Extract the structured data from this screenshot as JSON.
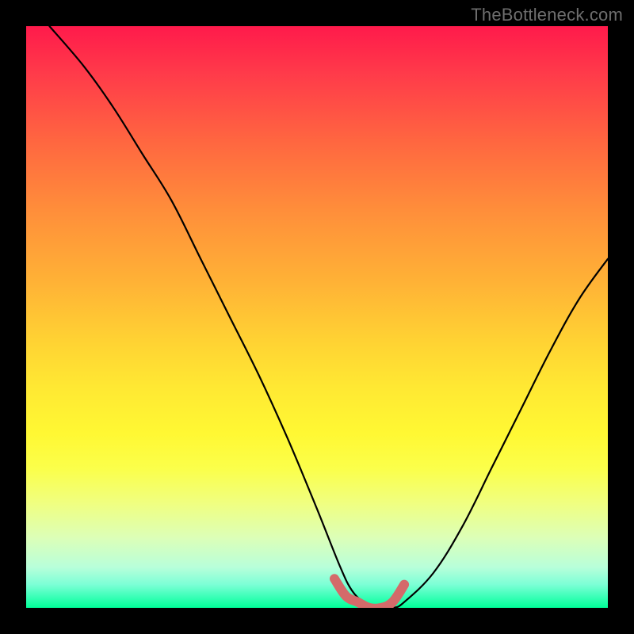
{
  "watermark": "TheBottleneck.com",
  "chart_data": {
    "type": "line",
    "title": "",
    "xlabel": "",
    "ylabel": "",
    "xlim": [
      0,
      100
    ],
    "ylim": [
      0,
      100
    ],
    "grid": false,
    "legend": false,
    "background": {
      "gradient": "vertical",
      "stops": [
        {
          "pos": 0,
          "color": "#ff1a4b"
        },
        {
          "pos": 20,
          "color": "#ff6740"
        },
        {
          "pos": 50,
          "color": "#ffd233"
        },
        {
          "pos": 80,
          "color": "#f0ff80"
        },
        {
          "pos": 100,
          "color": "#00ff99"
        }
      ]
    },
    "series": [
      {
        "name": "bottleneck-curve",
        "stroke": "#000000",
        "x": [
          4,
          10,
          15,
          20,
          25,
          30,
          35,
          40,
          45,
          50,
          54,
          56,
          58,
          60,
          63,
          65,
          70,
          75,
          80,
          85,
          90,
          95,
          100
        ],
        "y": [
          100,
          93,
          86,
          78,
          70,
          60,
          50,
          40,
          29,
          17,
          7,
          3,
          1,
          0,
          0,
          1,
          6,
          14,
          24,
          34,
          44,
          53,
          60
        ]
      },
      {
        "name": "optimal-band",
        "stroke": "#d46a6a",
        "thick": true,
        "x": [
          53,
          55,
          57,
          59,
          61,
          63,
          65
        ],
        "y": [
          5,
          2,
          1,
          0,
          0,
          1,
          4
        ]
      }
    ],
    "annotations": []
  }
}
